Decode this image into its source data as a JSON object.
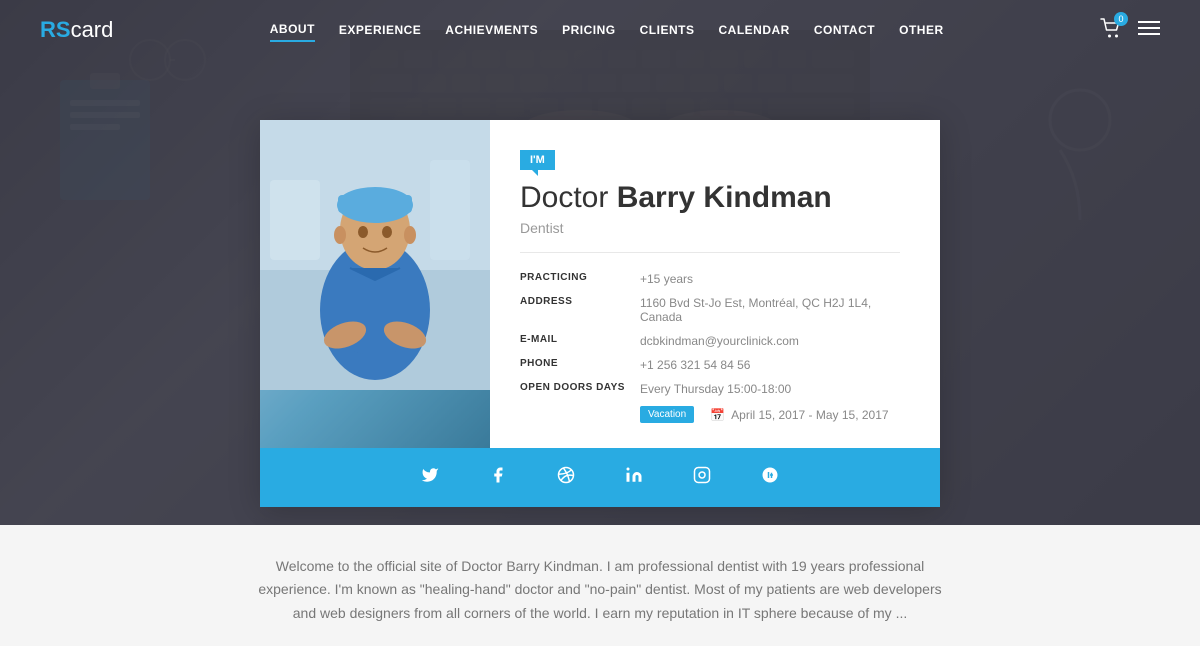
{
  "logo": {
    "rs": "RS",
    "card": "card"
  },
  "nav": {
    "items": [
      {
        "label": "ABOUT",
        "active": true
      },
      {
        "label": "EXPERIENCE",
        "active": false
      },
      {
        "label": "ACHIEVMENTS",
        "active": false
      },
      {
        "label": "PRICING",
        "active": false
      },
      {
        "label": "CLIENTS",
        "active": false
      },
      {
        "label": "CALENDAR",
        "active": false
      },
      {
        "label": "CONTACT",
        "active": false
      },
      {
        "label": "OTHER",
        "active": false
      }
    ],
    "cart_badge": "0"
  },
  "card": {
    "im_badge": "I'M",
    "doctor_prefix": "Doctor ",
    "doctor_name": "Barry Kindman",
    "doctor_title": "Dentist",
    "fields": [
      {
        "label": "PRACTICING",
        "value": "+15 years"
      },
      {
        "label": "ADDRESS",
        "value": "1160 Bvd St-Jo Est, Montréal, QC H2J 1L4, Canada"
      },
      {
        "label": "E-MAIL",
        "value": "dcbkindman@yourclinick.com"
      },
      {
        "label": "PHONE",
        "value": "+1 256 321 54 84 56"
      },
      {
        "label": "OPEN DOORS DAYS",
        "value": "Every Thursday 15:00-18:00"
      }
    ],
    "vacation_label": "Vacation",
    "vacation_dates": "April 15, 2017 - May 15, 2017"
  },
  "social": {
    "icons": [
      "twitter",
      "facebook",
      "dribbble",
      "linkedin",
      "instagram",
      "googleplus"
    ]
  },
  "bio": {
    "text": "Welcome to the official site of Doctor Barry Kindman. I am professional dentist with 19 years professional experience. I'm known as \"healing-hand\" doctor and \"no-pain\" dentist. Most of my patients are web developers and web designers from all corners of the world. I earn my reputation in IT sphere because of my ..."
  },
  "colors": {
    "accent": "#29abe2",
    "text_dark": "#333",
    "text_light": "#888"
  }
}
